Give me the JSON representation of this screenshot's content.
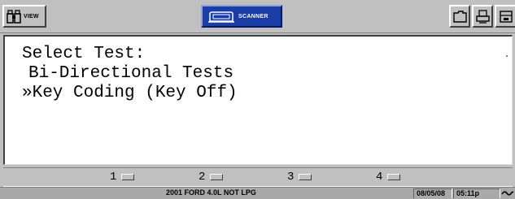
{
  "toolbar": {
    "view_label": "VIEW",
    "scanner_label": "SCANNER",
    "icons": [
      "view-binoculars-icon",
      "scanner-icon",
      "folder-icon",
      "printer-icon",
      "save-icon"
    ]
  },
  "screen": {
    "lines": [
      "Select Test:",
      "Bi-Directional Tests",
      "»Key Coding (Key Off)"
    ]
  },
  "function_keys": [
    {
      "label": "1"
    },
    {
      "label": "2"
    },
    {
      "label": "3"
    },
    {
      "label": "4"
    }
  ],
  "status": {
    "vehicle": "2001 FORD 4.0L NOT LPG",
    "date": "08/05/08",
    "time": "05:11p"
  },
  "colors": {
    "scanner_accent": "#1a3ea8",
    "background": "#c0c0c0",
    "screen": "#ffffff"
  }
}
